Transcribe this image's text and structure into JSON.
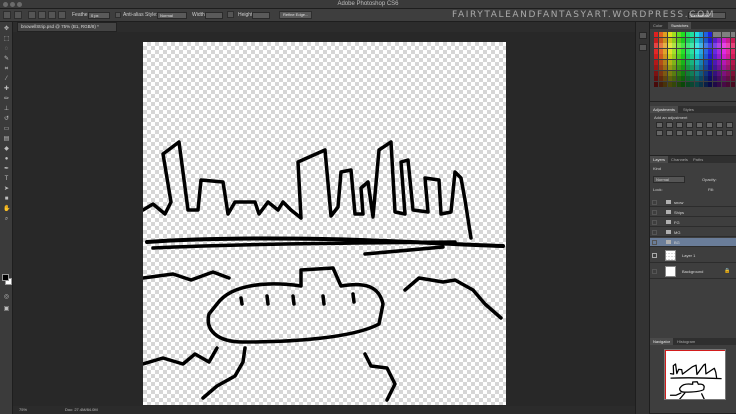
{
  "app": {
    "title": "Adobe Photoshop CS6"
  },
  "watermark": "FAIRYTALEANDFANTASYART.WORDPRESS.COM",
  "options_bar": {
    "feather_label": "Feather:",
    "feather_value": "0 px",
    "anti_alias_label": "Anti-alias",
    "style_label": "Style:",
    "style_value": "Normal",
    "width_label": "Width:",
    "height_label": "Height:",
    "refine_edge_label": "Refine Edge...",
    "workspace_value": "Essentials"
  },
  "document": {
    "tab_label": "bnowellStrip.psd @ 75% (B1, RGB/8) *",
    "zoom": "75%",
    "doc_size": "Doc: 27.4M/84.0M"
  },
  "panels": {
    "color_tabs": [
      "Color",
      "Swatches"
    ],
    "adjustments_tabs": [
      "Adjustments",
      "Styles"
    ],
    "adjustments_add_label": "Add an adjustment",
    "layers_tabs": [
      "Layers",
      "Channels",
      "Paths"
    ],
    "layers_kind_label": "Kind",
    "blend_mode": "Normal",
    "opacity_label": "Opacity:",
    "lock_label": "Lock:",
    "fill_label": "Fill:",
    "layers": [
      {
        "name": "snow",
        "type": "group",
        "selected": false
      },
      {
        "name": "Ships",
        "type": "group",
        "selected": false
      },
      {
        "name": "FG",
        "type": "group",
        "selected": false
      },
      {
        "name": "MG",
        "type": "group",
        "selected": false
      },
      {
        "name": "BG",
        "type": "group",
        "selected": true
      },
      {
        "name": "Layer 1",
        "type": "layer",
        "selected": false
      },
      {
        "name": "Background",
        "type": "background",
        "selected": false
      }
    ],
    "navigator_tabs": [
      "Navigator",
      "Histogram"
    ]
  },
  "colors": {
    "selection_highlight": "#6a7d99",
    "navigator_frame": "#d21b1b"
  }
}
